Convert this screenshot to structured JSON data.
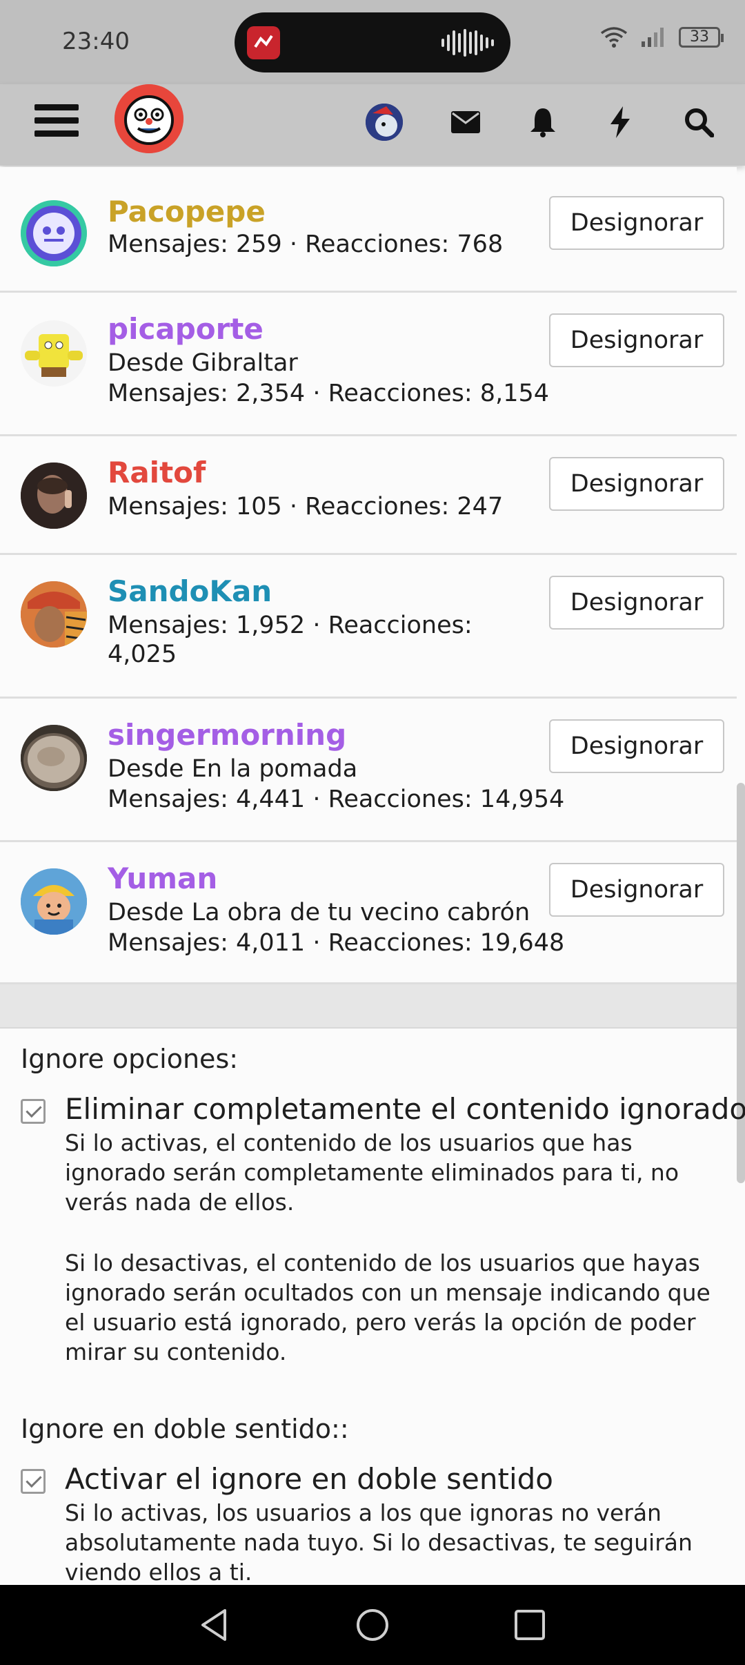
{
  "status_bar": {
    "time": "23:40",
    "battery": "33",
    "icons": [
      "app-notification-icon",
      "audio-wave-icon",
      "wifi-icon",
      "signal-icon",
      "battery-icon"
    ]
  },
  "header": {
    "icons": [
      "menu-icon",
      "site-logo",
      "user-avatar",
      "envelope-icon",
      "bell-icon",
      "bolt-icon",
      "search-icon"
    ]
  },
  "users": [
    {
      "name": "Pacopepe",
      "color": "#c9a227",
      "lines": [
        "Mensajes: 259 · Reacciones: 768"
      ],
      "button": "Designorar"
    },
    {
      "name": "picaporte",
      "color": "#a45ee5",
      "lines": [
        "Desde Gibraltar",
        "Mensajes: 2,354 · Reacciones: 8,154"
      ],
      "button": "Designorar"
    },
    {
      "name": "Raitof",
      "color": "#e2483d",
      "lines": [
        "Mensajes: 105 · Reacciones: 247"
      ],
      "button": "Designorar"
    },
    {
      "name": "SandoKan",
      "color": "#1e8fb4",
      "lines": [
        "Mensajes: 1,952 · Reacciones:",
        "4,025"
      ],
      "button": "Designorar"
    },
    {
      "name": "singermorning",
      "color": "#a45ee5",
      "lines": [
        "Desde En la pomada",
        "Mensajes: 4,441 · Reacciones: 14,954"
      ],
      "button": "Designorar"
    },
    {
      "name": "Yuman",
      "color": "#a45ee5",
      "lines": [
        "Desde La obra de tu vecino cabrón",
        "Mensajes: 4,011 · Reacciones: 19,648"
      ],
      "button": "Designorar"
    }
  ],
  "options": {
    "section1_title": "Ignore opciones:",
    "opt1_label": "Eliminar completamente el contenido ignorado",
    "opt1_checked": true,
    "opt1_desc1": "Si lo activas, el contenido de los usuarios que has ignorado serán completamente eliminados para ti, no verás nada de ellos.",
    "opt1_desc2": "Si lo desactivas, el contenido de los usuarios que hayas ignorado serán ocultados con un mensaje indicando que el usuario está ignorado, pero verás la opción de poder mirar su contenido.",
    "section2_title": "Ignore en doble sentido::",
    "opt2_label": "Activar el ignore en doble sentido",
    "opt2_checked": true,
    "opt2_desc": "Si lo activas, los usuarios a los que ignoras no verán absolutamente nada tuyo. Si lo desactivas, te seguirán viendo ellos a ti."
  },
  "nav": [
    "back-icon",
    "home-icon",
    "recents-icon"
  ]
}
